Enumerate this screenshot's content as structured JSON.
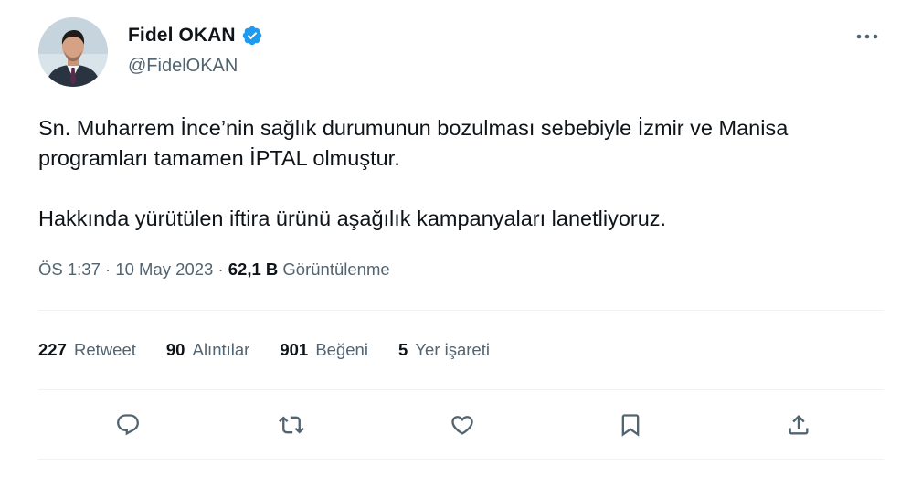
{
  "author": {
    "display_name": "Fidel OKAN",
    "handle": "@FidelOKAN",
    "verified": true,
    "verified_color": "#1d9bf0"
  },
  "menu": {
    "icon": "more-horizontal-icon"
  },
  "tweet": {
    "paragraphs": [
      "Sn. Muharrem İnce’nin sağlık durumunun bozulması sebebiyle İzmir ve Manisa programları tamamen İPTAL olmuştur.",
      "Hakkında yürütülen iftira ürünü aşağılık kampanyaları lanetliyoruz."
    ]
  },
  "meta": {
    "time": "ÖS 1:37",
    "separator": "·",
    "date": "10 May 2023",
    "views_count": "62,1 B",
    "views_label": "Görüntülenme"
  },
  "stats": {
    "retweets": {
      "count": "227",
      "label": "Retweet"
    },
    "quotes": {
      "count": "90",
      "label": "Alıntılar"
    },
    "likes": {
      "count": "901",
      "label": "Beğeni"
    },
    "bookmarks": {
      "count": "5",
      "label": "Yer işareti"
    }
  },
  "actions": [
    "reply-icon",
    "retweet-icon",
    "like-icon",
    "bookmark-icon",
    "share-icon"
  ],
  "colors": {
    "text_primary": "#0f1419",
    "text_secondary": "#536471",
    "divider": "#eff3f4",
    "accent": "#1d9bf0"
  }
}
